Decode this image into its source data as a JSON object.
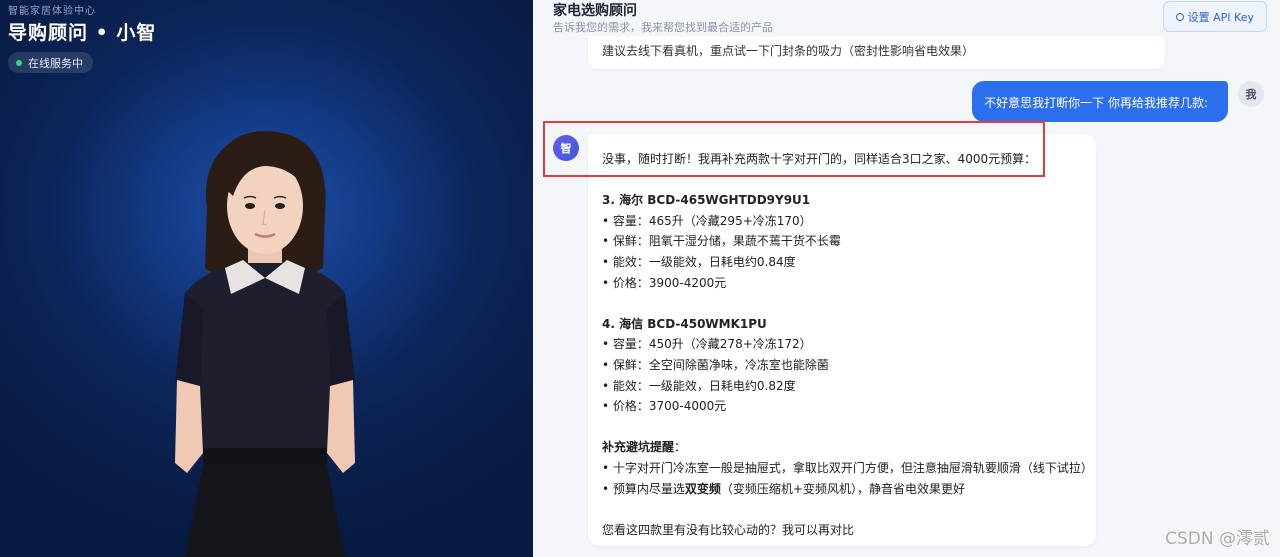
{
  "left_panel": {
    "subtitle": "智能家居体验中心",
    "title": "导购顾问 • 小智",
    "status": "在线服务中"
  },
  "header": {
    "title": "家电选购顾问",
    "subtitle": "告诉我您的需求，我来帮您找到最合适的产品",
    "api_key_button": "设置 API Key"
  },
  "chat": {
    "previous_bot_message_tail": "建议去线下看真机，重点试一下门封条的吸力（密封性影响省电效果）",
    "user_message": "不好意思我打断你一下 你再给我推荐几款:",
    "user_avatar": "我",
    "bot_avatar": "智",
    "bot_message": {
      "intro": "没事，随时打断！我再补充两款十字对开门的，同样适合3口之家、4000元预算：",
      "product3_title": "3. 海尔 BCD-465WGHTDD9Y9U1",
      "product3_l1": "• 容量：465升（冷藏295+冷冻170）",
      "product3_l2": "• 保鲜：阻氧干湿分储，果蔬不蔫干货不长霉",
      "product3_l3": "• 能效：一级能效，日耗电约0.84度",
      "product3_l4": "• 价格：3900-4200元",
      "product4_title": "4. 海信 BCD-450WMK1PU",
      "product4_l1": "• 容量：450升（冷藏278+冷冻172）",
      "product4_l2": "• 保鲜：全空间除菌净味，冷冻室也能除菌",
      "product4_l3": "• 能效：一级能效，日耗电约0.82度",
      "product4_l4": "• 价格：3700-4000元",
      "tips_title": "补充避坑提醒",
      "tips_colon": "：",
      "tip1": "• 十字对开门冷冻室一般是抽屉式，拿取比双开门方便，但注意抽屉滑轨要顺滑（线下试拉）",
      "tip2_prefix": "• 预算内尽量选",
      "tip2_bold": "双变频",
      "tip2_suffix": "（变频压缩机+变频风机），静音省电效果更好",
      "closing": "您看这四款里有没有比较心动的？我可以再对比"
    }
  },
  "watermark": "CSDN @澪贰",
  "colors": {
    "accent": "#2c6fee",
    "highlight": "#e23b3b",
    "status_dot": "#37d67a"
  }
}
